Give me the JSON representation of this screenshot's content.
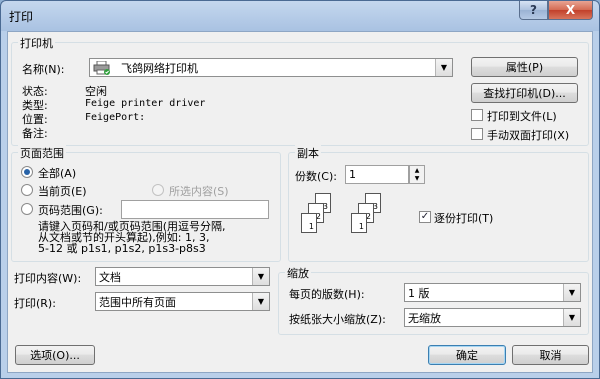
{
  "window": {
    "title": "打印",
    "help_glyph": "?",
    "close_glyph": "X"
  },
  "printer": {
    "group_title": "打印机",
    "name_label": "名称(N):",
    "name_value": "飞鸽网络打印机",
    "status_label": "状态:",
    "status_value": "空闲",
    "type_label": "类型:",
    "type_value": "Feige printer driver",
    "location_label": "位置:",
    "location_value": "FeigePort:",
    "comment_label": "备注:",
    "comment_value": "",
    "properties_button": "属性(P)",
    "find_printer_button": "查找打印机(D)...",
    "print_to_file_label": "打印到文件(L)",
    "print_to_file_checked": false,
    "manual_duplex_label": "手动双面打印(X)",
    "manual_duplex_checked": false
  },
  "page_range": {
    "group_title": "页面范围",
    "all_label": "全部(A)",
    "current_page_label": "当前页(E)",
    "selection_label": "所选内容(S)",
    "pages_label": "页码范围(G):",
    "pages_value": "",
    "selected_option": "all",
    "hint_lines": [
      "请键入页码和/或页码范围(用逗号分隔,",
      "从文档或节的开头算起),例如: 1, 3,",
      "5-12 或 p1s1, p1s2, p1s3-p8s3"
    ]
  },
  "copies": {
    "group_title": "副本",
    "count_label": "份数(C):",
    "count_value": "1",
    "collate_label": "逐份打印(T)",
    "collate_checked": true,
    "page_numbers": [
      "1",
      "2",
      "3"
    ]
  },
  "print_what": {
    "label": "打印内容(W):",
    "value": "文档"
  },
  "print_range": {
    "label": "打印(R):",
    "value": "范围中所有页面"
  },
  "zoom": {
    "group_title": "缩放",
    "pages_per_sheet_label": "每页的版数(H):",
    "pages_per_sheet_value": "1 版",
    "scale_label": "按纸张大小缩放(Z):",
    "scale_value": "无缩放"
  },
  "footer": {
    "options_button": "选项(O)...",
    "ok_button": "确定",
    "cancel_button": "取消"
  },
  "icons": {
    "printer": "printer-icon",
    "dropdown": "chevron-down-icon",
    "spin_up": "▲",
    "spin_down": "▼",
    "combo_arrow": "▼",
    "check_mark": "✓"
  }
}
